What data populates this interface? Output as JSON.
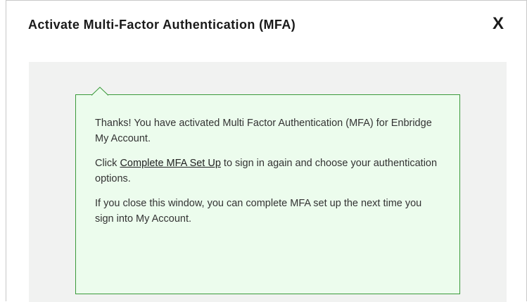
{
  "dialog": {
    "title": "Activate Multi-Factor Authentication (MFA)",
    "close_label": "X"
  },
  "callout": {
    "paragraph1": "Thanks! You have activated Multi Factor Authentication (MFA) for Enbridge My Account.",
    "paragraph2_prefix": "Click ",
    "paragraph2_link": "Complete MFA Set Up",
    "paragraph2_suffix": " to sign in again and choose your authentication options.",
    "paragraph3": "If you close this window, you can complete MFA set up the next time you sign into My Account."
  },
  "colors": {
    "callout_background": "#ecfced",
    "callout_border": "#3a9a3a",
    "body_background": "#f1f2f1"
  }
}
